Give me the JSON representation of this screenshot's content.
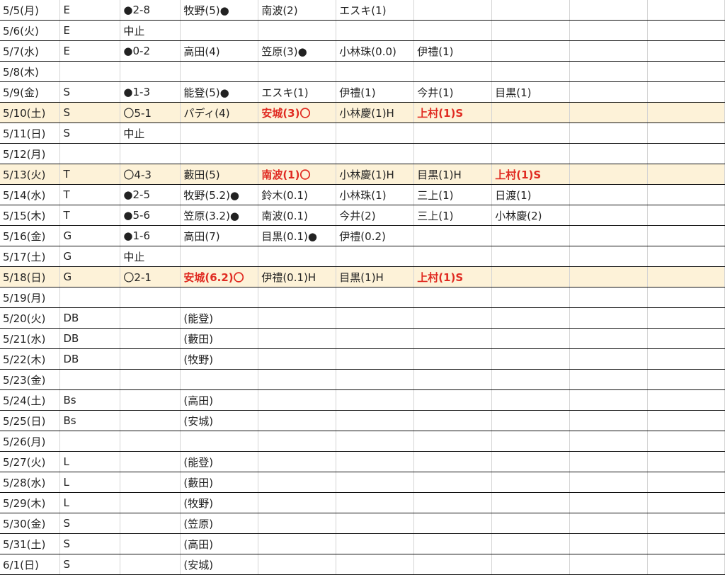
{
  "rows": [
    {
      "cells": [
        "5/5(月)",
        "E",
        "●2-8",
        "牧野(5)●",
        "南波(2)",
        "エスキ(1)",
        "",
        "",
        "",
        ""
      ],
      "red": [],
      "highlight": false
    },
    {
      "cells": [
        "5/6(火)",
        "E",
        "中止",
        "",
        "",
        "",
        "",
        "",
        "",
        ""
      ],
      "red": [],
      "highlight": false
    },
    {
      "cells": [
        "5/7(水)",
        "E",
        "●0-2",
        "高田(4)",
        "笠原(3)●",
        "小林珠(0.0)",
        "伊禮(1)",
        "",
        "",
        ""
      ],
      "red": [],
      "highlight": false
    },
    {
      "cells": [
        "5/8(木)",
        "",
        "",
        "",
        "",
        "",
        "",
        "",
        "",
        ""
      ],
      "red": [],
      "highlight": false
    },
    {
      "cells": [
        "5/9(金)",
        "S",
        "●1-3",
        "能登(5)●",
        "エスキ(1)",
        "伊禮(1)",
        "今井(1)",
        "目黒(1)",
        "",
        ""
      ],
      "red": [],
      "highlight": false
    },
    {
      "cells": [
        "5/10(土)",
        "S",
        "〇5-1",
        "パディ(4)",
        "安城(3)〇",
        "小林慶(1)H",
        "上村(1)S",
        "",
        "",
        ""
      ],
      "red": [
        4,
        6
      ],
      "highlight": true
    },
    {
      "cells": [
        "5/11(日)",
        "S",
        "中止",
        "",
        "",
        "",
        "",
        "",
        "",
        ""
      ],
      "red": [],
      "highlight": false
    },
    {
      "cells": [
        "5/12(月)",
        "",
        "",
        "",
        "",
        "",
        "",
        "",
        "",
        ""
      ],
      "red": [],
      "highlight": false
    },
    {
      "cells": [
        "5/13(火)",
        "T",
        "〇4-3",
        "藪田(5)",
        "南波(1)〇",
        "小林慶(1)H",
        "目黒(1)H",
        "上村(1)S",
        "",
        ""
      ],
      "red": [
        4,
        7
      ],
      "highlight": true
    },
    {
      "cells": [
        "5/14(水)",
        "T",
        "●2-5",
        "牧野(5.2)●",
        "鈴木(0.1)",
        "小林珠(1)",
        "三上(1)",
        "日渡(1)",
        "",
        ""
      ],
      "red": [],
      "highlight": false
    },
    {
      "cells": [
        "5/15(木)",
        "T",
        "●5-6",
        "笠原(3.2)●",
        "南波(0.1)",
        "今井(2)",
        "三上(1)",
        "小林慶(2)",
        "",
        ""
      ],
      "red": [],
      "highlight": false
    },
    {
      "cells": [
        "5/16(金)",
        "G",
        "●1-6",
        "高田(7)",
        "目黒(0.1)●",
        "伊禮(0.2)",
        "",
        "",
        "",
        ""
      ],
      "red": [],
      "highlight": false
    },
    {
      "cells": [
        "5/17(土)",
        "G",
        "中止",
        "",
        "",
        "",
        "",
        "",
        "",
        ""
      ],
      "red": [],
      "highlight": false
    },
    {
      "cells": [
        "5/18(日)",
        "G",
        "〇2-1",
        "安城(6.2)〇",
        "伊禮(0.1)H",
        "目黒(1)H",
        "上村(1)S",
        "",
        "",
        ""
      ],
      "red": [
        3,
        6
      ],
      "highlight": true
    },
    {
      "cells": [
        "5/19(月)",
        "",
        "",
        "",
        "",
        "",
        "",
        "",
        "",
        ""
      ],
      "red": [],
      "highlight": false
    },
    {
      "cells": [
        "5/20(火)",
        "DB",
        "",
        "(能登)",
        "",
        "",
        "",
        "",
        "",
        ""
      ],
      "red": [],
      "highlight": false
    },
    {
      "cells": [
        "5/21(水)",
        "DB",
        "",
        "(藪田)",
        "",
        "",
        "",
        "",
        "",
        ""
      ],
      "red": [],
      "highlight": false
    },
    {
      "cells": [
        "5/22(木)",
        "DB",
        "",
        "(牧野)",
        "",
        "",
        "",
        "",
        "",
        ""
      ],
      "red": [],
      "highlight": false
    },
    {
      "cells": [
        "5/23(金)",
        "",
        "",
        "",
        "",
        "",
        "",
        "",
        "",
        ""
      ],
      "red": [],
      "highlight": false
    },
    {
      "cells": [
        "5/24(土)",
        "Bs",
        "",
        "(高田)",
        "",
        "",
        "",
        "",
        "",
        ""
      ],
      "red": [],
      "highlight": false
    },
    {
      "cells": [
        "5/25(日)",
        "Bs",
        "",
        "(安城)",
        "",
        "",
        "",
        "",
        "",
        ""
      ],
      "red": [],
      "highlight": false
    },
    {
      "cells": [
        "5/26(月)",
        "",
        "",
        "",
        "",
        "",
        "",
        "",
        "",
        ""
      ],
      "red": [],
      "highlight": false
    },
    {
      "cells": [
        "5/27(火)",
        "L",
        "",
        "(能登)",
        "",
        "",
        "",
        "",
        "",
        ""
      ],
      "red": [],
      "highlight": false
    },
    {
      "cells": [
        "5/28(水)",
        "L",
        "",
        "(藪田)",
        "",
        "",
        "",
        "",
        "",
        ""
      ],
      "red": [],
      "highlight": false
    },
    {
      "cells": [
        "5/29(木)",
        "L",
        "",
        "(牧野)",
        "",
        "",
        "",
        "",
        "",
        ""
      ],
      "red": [],
      "highlight": false
    },
    {
      "cells": [
        "5/30(金)",
        "S",
        "",
        "(笠原)",
        "",
        "",
        "",
        "",
        "",
        ""
      ],
      "red": [],
      "highlight": false
    },
    {
      "cells": [
        "5/31(土)",
        "S",
        "",
        "(高田)",
        "",
        "",
        "",
        "",
        "",
        ""
      ],
      "red": [],
      "highlight": false
    },
    {
      "cells": [
        "6/1(日)",
        "S",
        "",
        "(安城)",
        "",
        "",
        "",
        "",
        "",
        ""
      ],
      "red": [],
      "highlight": false
    }
  ],
  "colors": {
    "highlight_row": "#fdf2d8",
    "emphasis_text": "#e02b22",
    "row_border": "#111111",
    "column_border": "#d4d4d4"
  }
}
